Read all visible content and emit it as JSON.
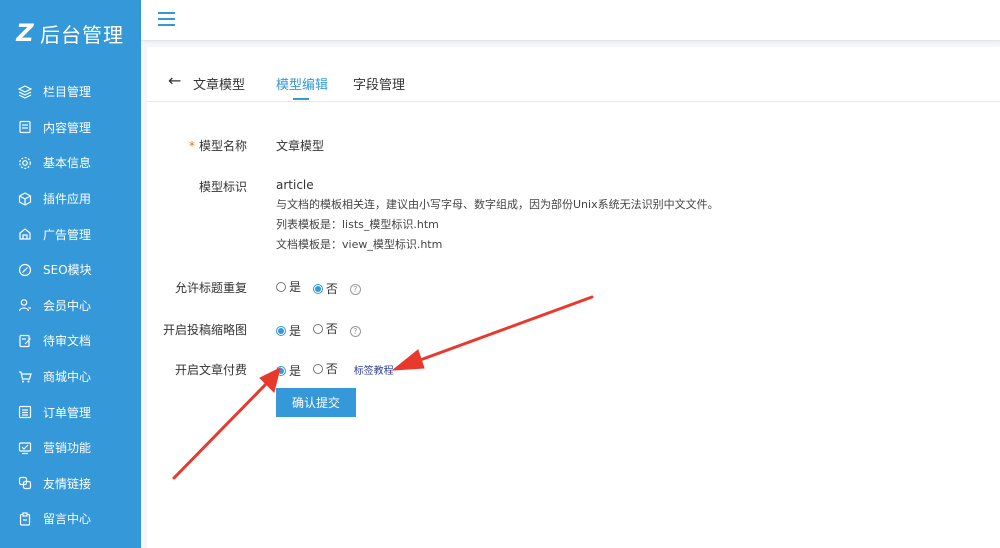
{
  "logo": {
    "mark": "Z",
    "text": "后台管理"
  },
  "sidebar": {
    "items": [
      {
        "label": "栏目管理",
        "icon": "layers-icon"
      },
      {
        "label": "内容管理",
        "icon": "document-icon"
      },
      {
        "label": "基本信息",
        "icon": "gear-icon"
      },
      {
        "label": "插件应用",
        "icon": "cube-icon"
      },
      {
        "label": "广告管理",
        "icon": "ad-icon"
      },
      {
        "label": "SEO模块",
        "icon": "seo-icon"
      },
      {
        "label": "会员中心",
        "icon": "user-icon"
      },
      {
        "label": "待审文档",
        "icon": "edit-doc-icon"
      },
      {
        "label": "商城中心",
        "icon": "cart-icon"
      },
      {
        "label": "订单管理",
        "icon": "list-icon"
      },
      {
        "label": "营销功能",
        "icon": "marketing-icon"
      },
      {
        "label": "友情链接",
        "icon": "link-icon"
      },
      {
        "label": "留言中心",
        "icon": "clipboard-icon"
      }
    ]
  },
  "tabs": {
    "back_arrow": "←",
    "title": "文章模型",
    "edit": "模型编辑",
    "fields": "字段管理"
  },
  "form": {
    "required_mark": "*",
    "name_label": "模型名称",
    "name_value": "文章模型",
    "ident_label": "模型标识",
    "ident_value": "article",
    "ident_hint1": "与文档的模板相关连，建议由小写字母、数字组成，因为部份Unix系统无法识别中文文件。",
    "ident_hint2": "列表模板是：lists_模型标识.htm",
    "ident_hint3": "文档模板是：view_模型标识.htm",
    "dup_label": "允许标题重复",
    "thumb_label": "开启投稿缩略图",
    "pay_label": "开启文章付费",
    "yes": "是",
    "no": "否",
    "help": "?",
    "tutorial_link": "标签教程",
    "submit": "确认提交"
  },
  "state": {
    "dup": "no",
    "thumb": "yes",
    "pay": "yes"
  },
  "colors": {
    "accent": "#3598d8",
    "annotation": "#e8392c"
  }
}
